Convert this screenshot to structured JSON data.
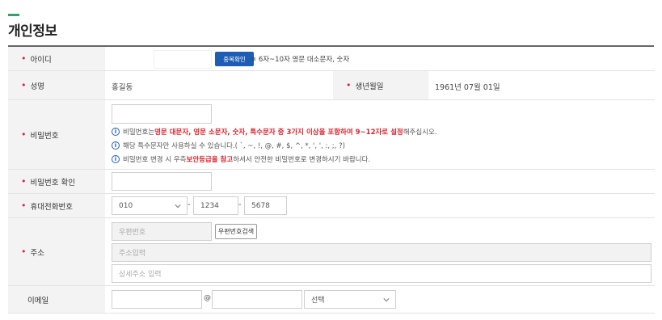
{
  "colors": {
    "accent": "#2fa36b",
    "required": "#d9252f",
    "button": "#1e5db5"
  },
  "page": {
    "title": "개인정보"
  },
  "required_mark": "•",
  "fields": {
    "userid": {
      "label": "아이디",
      "check_button": "중복확인",
      "hint": "※ 6자~10자 영문 대소문자, 숫자"
    },
    "name": {
      "label": "성명",
      "value": "홍길동"
    },
    "birthdate": {
      "label": "생년월일",
      "value": "1961년 07월 01일"
    },
    "password": {
      "label": "비밀번호",
      "info_icon": "info-circle-icon",
      "hint1_pre": "비밀번호는 ",
      "hint1_em": "영문 대문자, 영문 소문자, 숫자, 특수문자 중 3가지 이상을 포함하여 9~12자로 설정",
      "hint1_post": "해주십시오.",
      "hint2": "해당 특수문자만 사용하실 수 있습니다.( `, ~, !, @, #, $, ^, *, ', ', :, ;, ?)",
      "hint3_pre": "비밀번호 변경 시 우측 ",
      "hint3_em": "보안등급을 참고",
      "hint3_post": "하셔서 안전한 비밀번호로 변경하시기 바랍니다."
    },
    "password_confirm": {
      "label": "비밀번호 확인"
    },
    "phone": {
      "label": "휴대전화번호",
      "prefix": "010",
      "middle": "1234",
      "last": "5678",
      "separator": "-",
      "dropdown_icon": "chevron-down-icon"
    },
    "address": {
      "label": "주소",
      "zip_placeholder": "우편번호",
      "search_button": "우편번호검색",
      "addr_placeholder": "주소입력",
      "detail_placeholder": "상세주소 입력"
    },
    "email": {
      "label": "이메일",
      "at": "@",
      "domain_select": "선택",
      "dropdown_icon": "chevron-down-icon"
    }
  }
}
